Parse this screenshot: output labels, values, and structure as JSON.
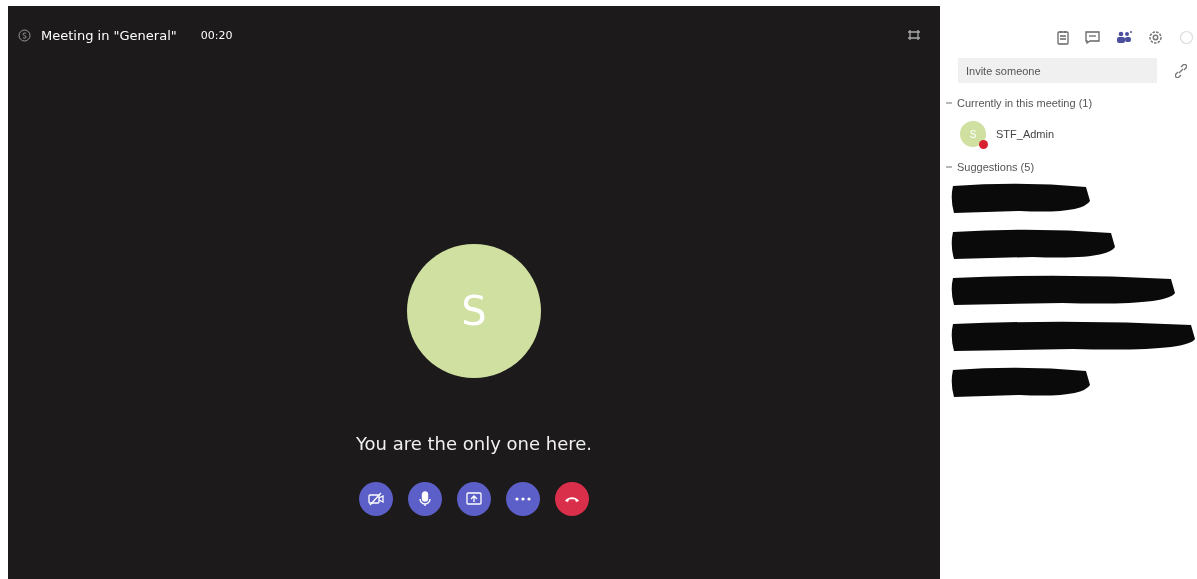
{
  "meeting": {
    "title": "Meeting in \"General\"",
    "timer": "00:20",
    "avatar_initial": "S",
    "message": "You are the only one here.",
    "controls": [
      {
        "kind": "video-off"
      },
      {
        "kind": "mic"
      },
      {
        "kind": "share"
      },
      {
        "kind": "more"
      },
      {
        "kind": "hang-up"
      }
    ]
  },
  "side_panel": {
    "toolbar": [
      {
        "kind": "notes"
      },
      {
        "kind": "chat"
      },
      {
        "kind": "people"
      },
      {
        "kind": "settings"
      },
      {
        "kind": "info"
      }
    ],
    "invite": {
      "placeholder": "Invite someone"
    },
    "sections": [
      {
        "label": "Currently in this meeting (1)",
        "expanded": true,
        "items": [
          {
            "kind": "person",
            "name": "STF_Admin",
            "initial": "S",
            "color": "#d92231"
          }
        ]
      },
      {
        "label": "Suggestions (5)",
        "expanded": true,
        "items": [
          {
            "kind": "redacted"
          },
          {
            "kind": "redacted"
          },
          {
            "kind": "redacted"
          },
          {
            "kind": "redacted"
          },
          {
            "kind": "redacted"
          }
        ]
      }
    ]
  }
}
